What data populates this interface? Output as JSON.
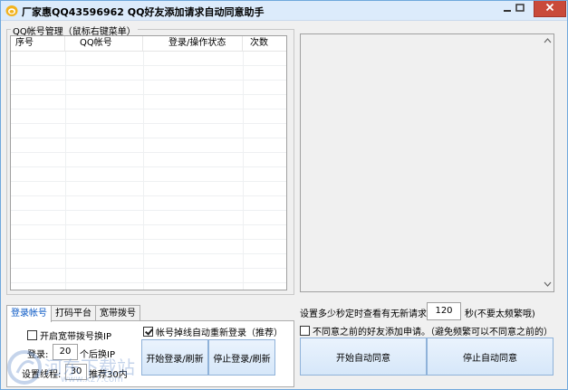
{
  "window": {
    "title": "厂家惠QQ43596962 QQ好友添加请求自动同意助手"
  },
  "account_group": {
    "label": "QQ帐号管理（鼠标右键菜单）",
    "columns": [
      "序号",
      "QQ帐号",
      "登录/操作状态",
      "次数"
    ]
  },
  "tabs": [
    {
      "label": "登录帐号"
    },
    {
      "label": "打码平台"
    },
    {
      "label": "宽带拨号"
    }
  ],
  "login_panel": {
    "broadband_ip_label": "开启宽带拨号换IP",
    "auto_relogin_label": "帐号掉线自动重新登录（推荐）",
    "login_label": "登录:",
    "login_value": "20",
    "after_ip_label": "个后换IP",
    "threads_label": "设置线程:",
    "threads_value": "30",
    "threads_hint": "推荐30内",
    "start_login_button": "开始登录/刷新",
    "stop_login_button": "停止登录/刷新"
  },
  "right_panel": {
    "interval_label": "设置多少秒定时查看有无新请求:",
    "interval_value": "120",
    "interval_hint": "秒(不要太频繁哦)",
    "reject_previous_label": "不同意之前的好友添加申请。（避免频繁可以不同意之前的）",
    "start_button": "开始自动同意",
    "stop_button": "停止自动同意"
  },
  "watermark": {
    "text": "河东下载站",
    "url": "www.xz7.com"
  },
  "colors": {
    "accent": "#0a58c4",
    "close": "#c94a3a",
    "title_bg": "#dcebfb"
  }
}
